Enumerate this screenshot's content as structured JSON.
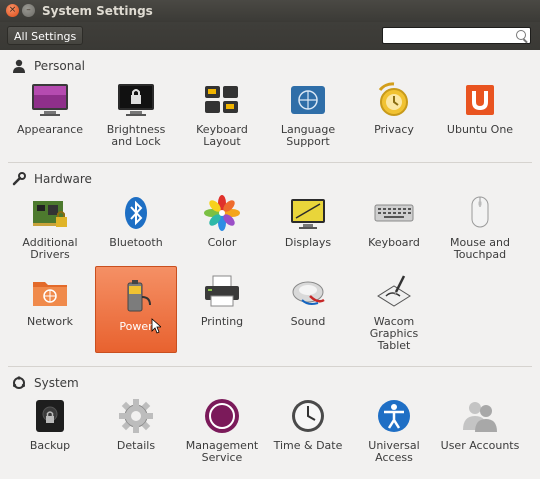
{
  "window": {
    "title": "System Settings",
    "close_glyph": "×",
    "minimize_glyph": "–"
  },
  "toolbar": {
    "all_settings_label": "All Settings",
    "search_placeholder": ""
  },
  "sections": {
    "personal": {
      "title": "Personal",
      "icon": "person-icon",
      "items": [
        {
          "label": "Appearance",
          "icon": "appearance-icon"
        },
        {
          "label": "Brightness and Lock",
          "icon": "brightness-lock-icon"
        },
        {
          "label": "Keyboard Layout",
          "icon": "keyboard-layout-icon"
        },
        {
          "label": "Language Support",
          "icon": "language-support-icon"
        },
        {
          "label": "Privacy",
          "icon": "privacy-icon"
        },
        {
          "label": "Ubuntu One",
          "icon": "ubuntu-one-icon"
        }
      ]
    },
    "hardware": {
      "title": "Hardware",
      "icon": "wrench-icon",
      "items": [
        {
          "label": "Additional Drivers",
          "icon": "drivers-icon"
        },
        {
          "label": "Bluetooth",
          "icon": "bluetooth-icon"
        },
        {
          "label": "Color",
          "icon": "color-icon"
        },
        {
          "label": "Displays",
          "icon": "displays-icon"
        },
        {
          "label": "Keyboard",
          "icon": "keyboard-icon"
        },
        {
          "label": "Mouse and Touchpad",
          "icon": "mouse-icon"
        },
        {
          "label": "Network",
          "icon": "network-icon"
        },
        {
          "label": "Power",
          "icon": "power-icon",
          "selected": true
        },
        {
          "label": "Printing",
          "icon": "printer-icon"
        },
        {
          "label": "Sound",
          "icon": "sound-icon"
        },
        {
          "label": "Wacom Graphics Tablet",
          "icon": "wacom-tablet-icon"
        }
      ]
    },
    "system": {
      "title": "System",
      "icon": "ubuntu-logo-icon",
      "items": [
        {
          "label": "Backup",
          "icon": "backup-icon"
        },
        {
          "label": "Details",
          "icon": "gear-icon"
        },
        {
          "label": "Management Service",
          "icon": "management-service-icon"
        },
        {
          "label": "Time & Date",
          "icon": "clock-icon"
        },
        {
          "label": "Universal Access",
          "icon": "universal-access-icon"
        },
        {
          "label": "User Accounts",
          "icon": "user-accounts-icon"
        }
      ]
    }
  },
  "colors": {
    "selected": "#e8622f",
    "titlebar": "#3b3a36",
    "background": "#f2f1f0"
  }
}
